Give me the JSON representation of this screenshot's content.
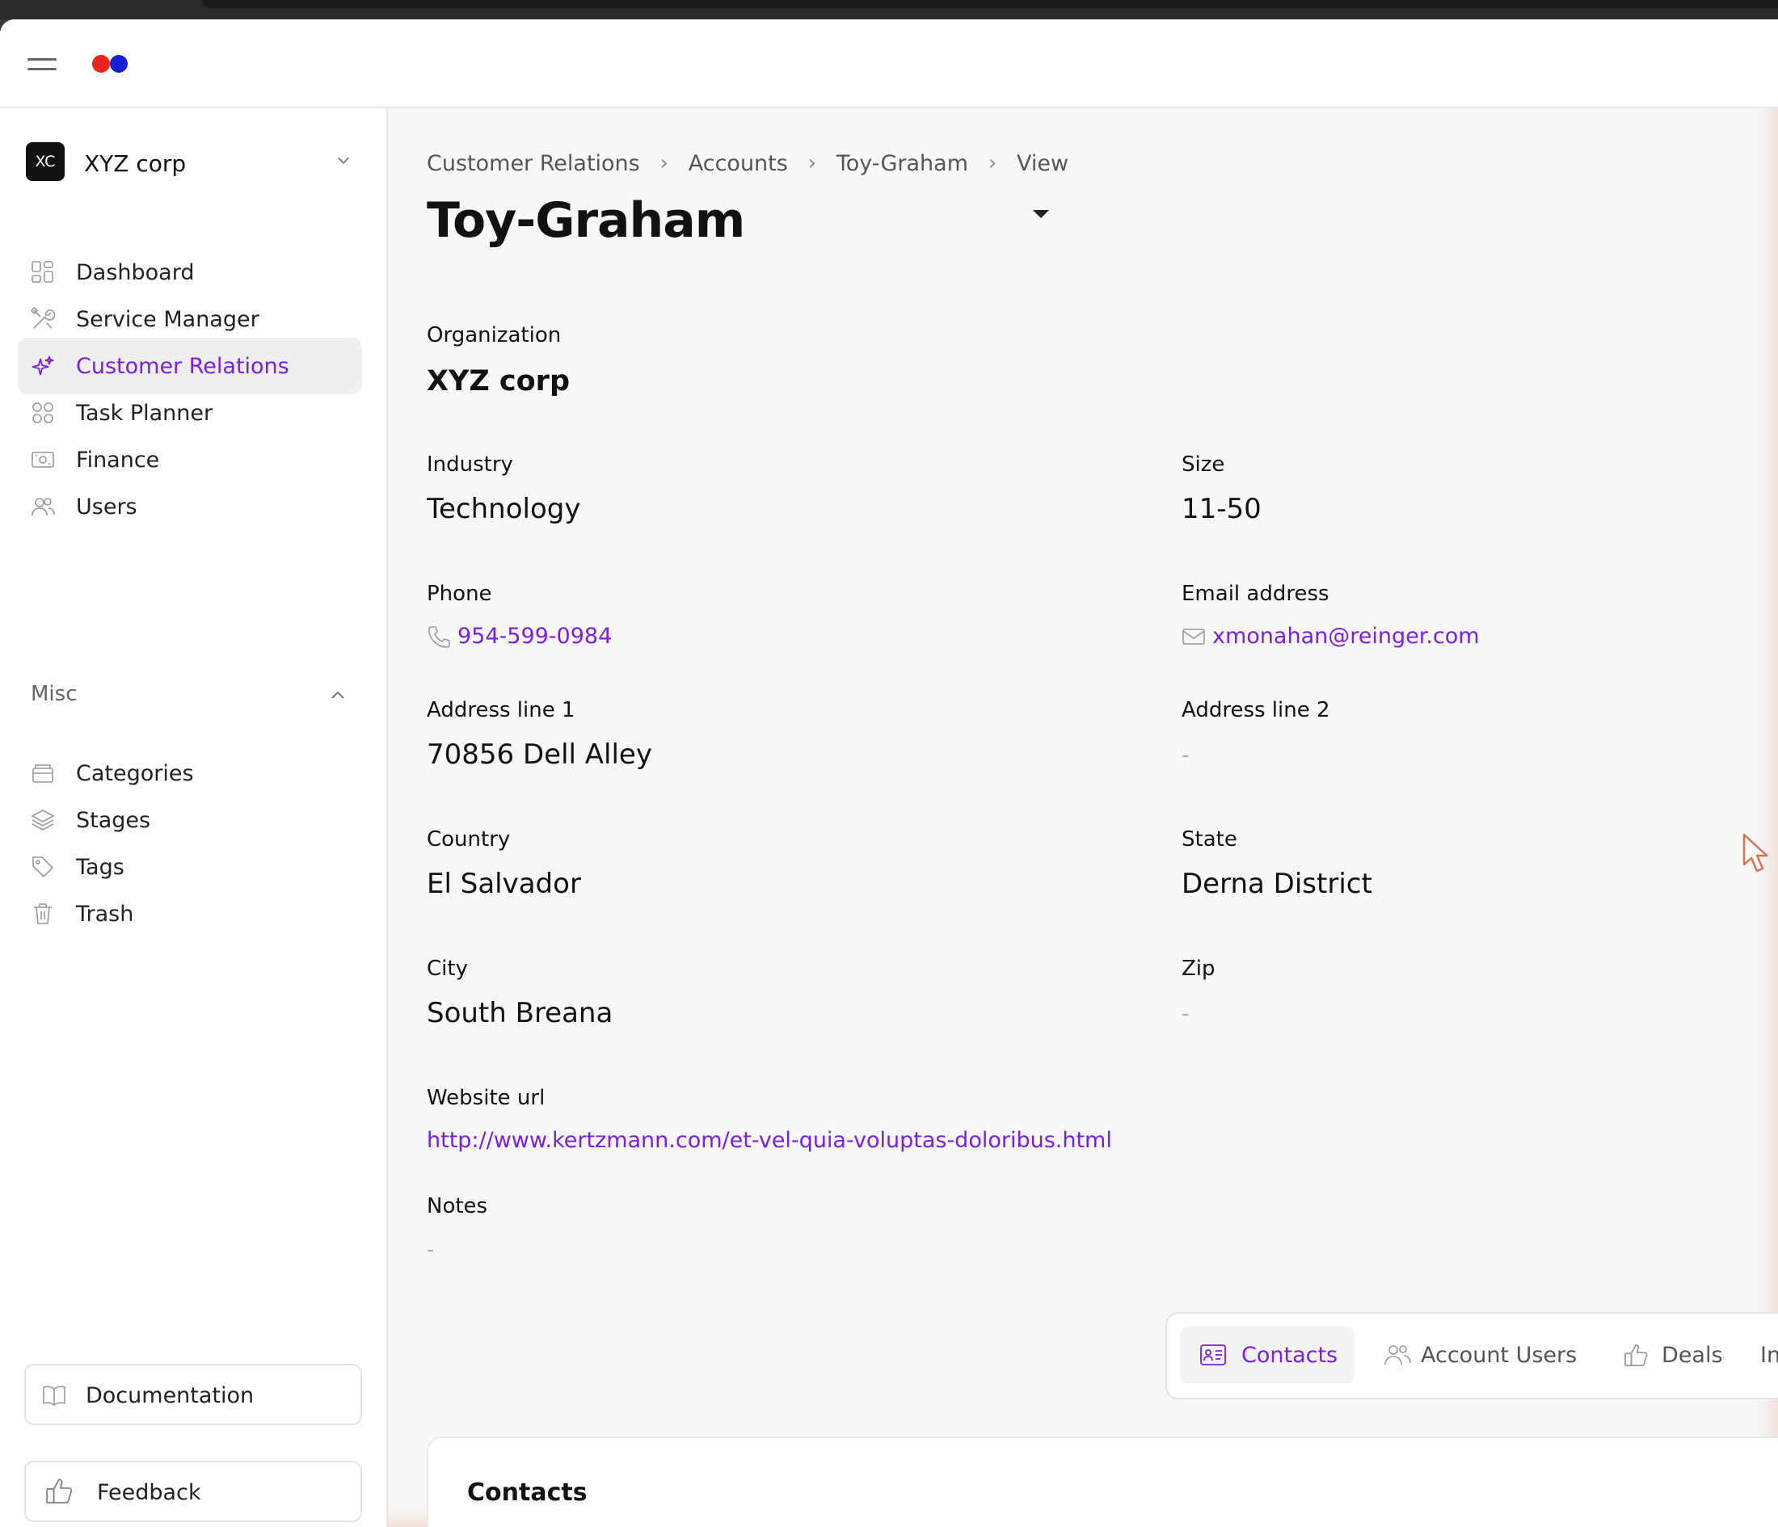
{
  "header": {
    "logo_colors": [
      "#e8261a",
      "#1520d8"
    ]
  },
  "sidebar": {
    "org": {
      "initials": "XC",
      "name": "XYZ corp"
    },
    "items": [
      {
        "label": "Dashboard",
        "icon": "grid-icon"
      },
      {
        "label": "Service Manager",
        "icon": "tools-icon"
      },
      {
        "label": "Customer Relations",
        "icon": "sparkle-icon",
        "active": true
      },
      {
        "label": "Task Planner",
        "icon": "apps-icon"
      },
      {
        "label": "Finance",
        "icon": "banknote-icon"
      },
      {
        "label": "Users",
        "icon": "users-icon"
      }
    ],
    "misc_label": "Misc",
    "misc_items": [
      {
        "label": "Categories",
        "icon": "archive-icon"
      },
      {
        "label": "Stages",
        "icon": "layers-icon"
      },
      {
        "label": "Tags",
        "icon": "tag-icon"
      },
      {
        "label": "Trash",
        "icon": "trash-icon"
      }
    ],
    "documentation_label": "Documentation",
    "feedback_label": "Feedback"
  },
  "breadcrumb": [
    "Customer Relations",
    "Accounts",
    "Toy-Graham",
    "View"
  ],
  "page_title": "Toy-Graham",
  "fields": {
    "organization": {
      "label": "Organization",
      "value": "XYZ corp"
    },
    "industry": {
      "label": "Industry",
      "value": "Technology"
    },
    "size": {
      "label": "Size",
      "value": "11-50"
    },
    "phone": {
      "label": "Phone",
      "value": "954-599-0984"
    },
    "email": {
      "label": "Email address",
      "value": "xmonahan@reinger.com"
    },
    "address1": {
      "label": "Address line 1",
      "value": "70856 Dell Alley"
    },
    "address2": {
      "label": "Address line 2",
      "value": "-"
    },
    "country": {
      "label": "Country",
      "value": "El Salvador"
    },
    "state": {
      "label": "State",
      "value": "Derna District"
    },
    "city": {
      "label": "City",
      "value": "South Breana"
    },
    "zip": {
      "label": "Zip",
      "value": "-"
    },
    "website": {
      "label": "Website url",
      "value": "http://www.kertzmann.com/et-vel-quia-voluptas-doloribus.html"
    },
    "notes": {
      "label": "Notes",
      "value": "-"
    }
  },
  "tabs": [
    {
      "label": "Contacts",
      "icon": "contact-card-icon",
      "active": true
    },
    {
      "label": "Account Users",
      "icon": "users-icon"
    },
    {
      "label": "Deals",
      "icon": "thumbs-up-icon"
    },
    {
      "label": "In",
      "icon": ""
    }
  ],
  "contacts_card": {
    "title": "Contacts"
  },
  "colors": {
    "accent": "#7b1fe4",
    "text": "#111111",
    "muted": "#555555"
  }
}
